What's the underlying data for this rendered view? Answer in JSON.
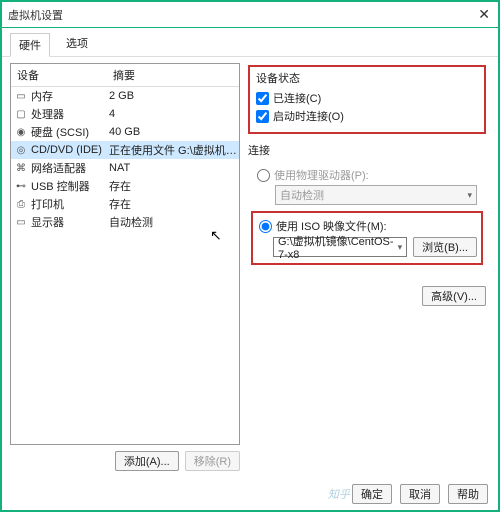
{
  "title": "虚拟机设置",
  "tabs": {
    "hardware": "硬件",
    "options": "选项"
  },
  "dev_header": {
    "device": "设备",
    "summary": "摘要"
  },
  "devices": [
    {
      "icon": "▭",
      "name": "内存",
      "summary": "2 GB"
    },
    {
      "icon": "▢",
      "name": "处理器",
      "summary": "4"
    },
    {
      "icon": "◉",
      "name": "硬盘 (SCSI)",
      "summary": "40 GB"
    },
    {
      "icon": "◎",
      "name": "CD/DVD (IDE)",
      "summary": "正在使用文件 G:\\虚拟机镜像\\C..."
    },
    {
      "icon": "⌘",
      "name": "网络适配器",
      "summary": "NAT"
    },
    {
      "icon": "⊷",
      "name": "USB 控制器",
      "summary": "存在"
    },
    {
      "icon": "⎙",
      "name": "打印机",
      "summary": "存在"
    },
    {
      "icon": "▭",
      "name": "显示器",
      "summary": "自动检测"
    }
  ],
  "left_buttons": {
    "add": "添加(A)...",
    "remove": "移除(R)"
  },
  "status": {
    "title": "设备状态",
    "connected": "已连接(C)",
    "connect_on_power": "启动时连接(O)"
  },
  "conn": {
    "title": "连接",
    "physical": "使用物理驱动器(P):",
    "autodetect": "自动检测",
    "iso_label": "使用 ISO 映像文件(M):",
    "iso_path": "G:\\虚拟机镜像\\CentOS-7-x8",
    "browse": "浏览(B)..."
  },
  "advanced": "高级(V)...",
  "footer": {
    "ok": "确定",
    "cancel": "取消",
    "help": "帮助"
  },
  "watermark": "知乎 @asuu"
}
